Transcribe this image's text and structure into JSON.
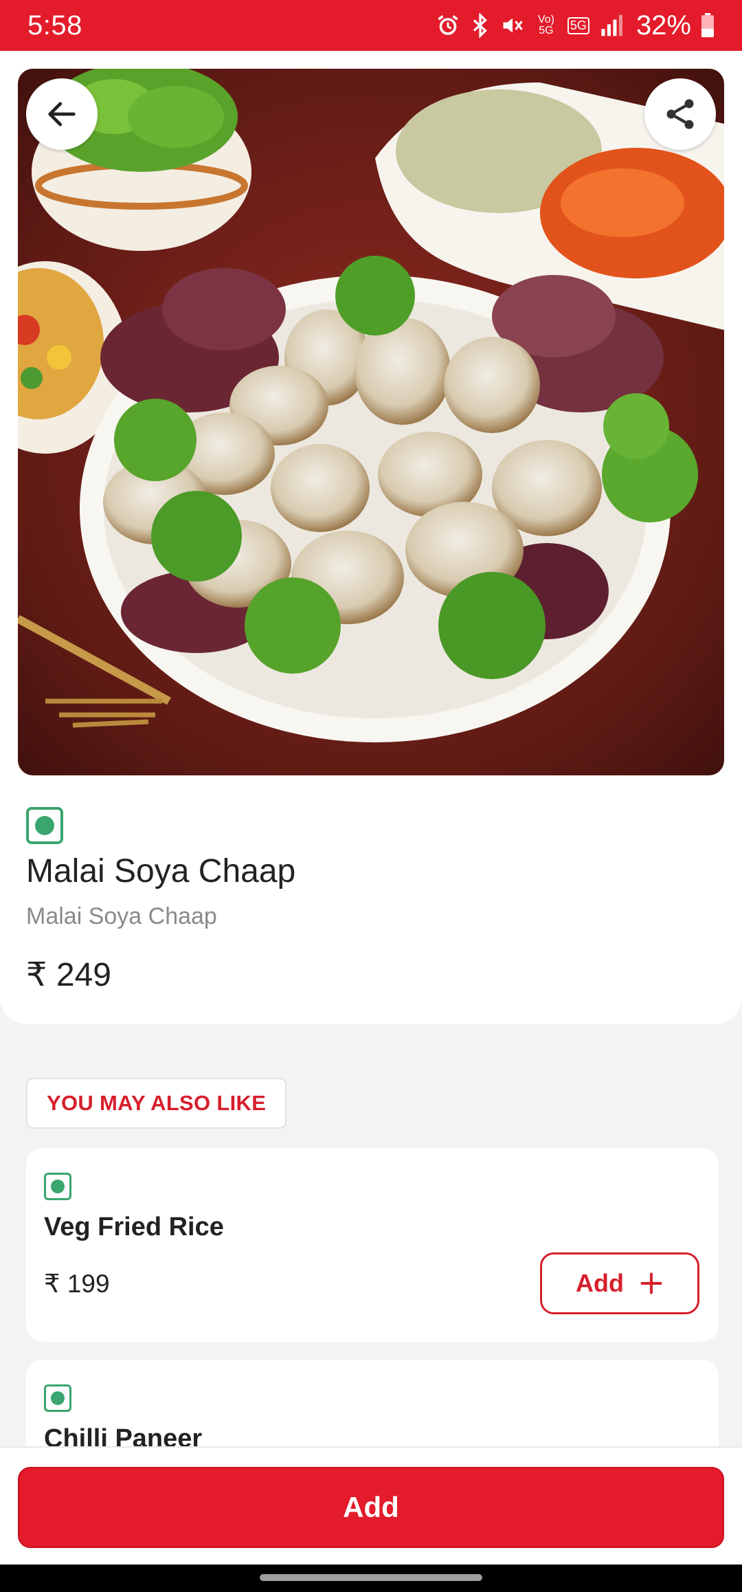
{
  "status_bar": {
    "time": "5:58",
    "network_label": "Vo) 5G",
    "network2_label": "5G",
    "battery": "32%"
  },
  "product": {
    "veg_indicator": "veg",
    "name": "Malai Soya Chaap",
    "description": "Malai Soya Chaap",
    "price": "₹ 249"
  },
  "icons": {
    "back": "arrow-left-icon",
    "share": "share-icon"
  },
  "recommendations": {
    "heading": "YOU MAY ALSO LIKE",
    "items": [
      {
        "name": "Veg Fried Rice",
        "price": "₹ 199",
        "add_label": "Add",
        "veg": true
      },
      {
        "name": "Chilli Paneer",
        "veg": true
      }
    ]
  },
  "footer": {
    "add_label": "Add"
  },
  "colors": {
    "brand_red": "#e31b2a",
    "veg_green": "#3aa56e"
  }
}
